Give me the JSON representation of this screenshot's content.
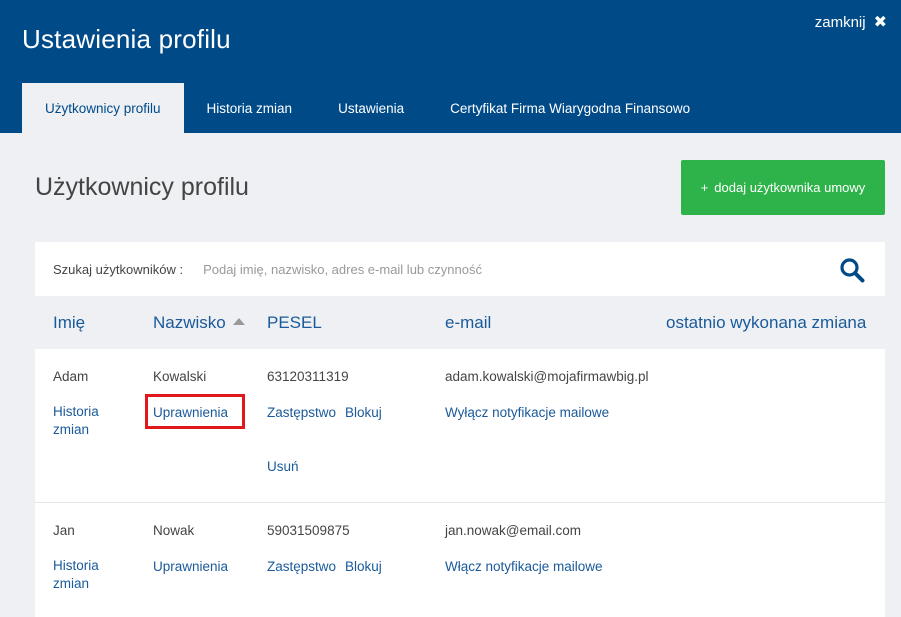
{
  "header": {
    "title": "Ustawienia profilu",
    "close_label": "zamknij",
    "close_icon": "✖"
  },
  "tabs": [
    {
      "label": "Użytkownicy profilu",
      "active": true
    },
    {
      "label": "Historia zmian",
      "active": false
    },
    {
      "label": "Ustawienia",
      "active": false
    },
    {
      "label": "Certyfikat Firma Wiarygodna Finansowo",
      "active": false
    }
  ],
  "main": {
    "title": "Użytkownicy profilu",
    "add_button_icon": "+",
    "add_button_label": "dodaj użytkownika umowy"
  },
  "search": {
    "label": "Szukaj użytkowników :",
    "placeholder": "Podaj imię, nazwisko, adres e-mail lub czynność",
    "value": ""
  },
  "table": {
    "columns": [
      "Imię",
      "Nazwisko",
      "PESEL",
      "e-mail",
      "ostatnio wykonana zmiana"
    ],
    "sort_column": "Nazwisko",
    "sort_direction": "ascending",
    "rows": [
      {
        "first_name": "Adam",
        "last_name": "Kowalski",
        "pesel": "63120311319",
        "email": "adam.kowalski@mojafirmawbig.pl",
        "history_link": "Historia zmian",
        "permissions_link": "Uprawnienia",
        "substitute_link": "Zastępstwo",
        "block_link": "Blokuj",
        "delete_link": "Usuń",
        "notify_link": "Wyłącz notyfikacje mailowe"
      },
      {
        "first_name": "Jan",
        "last_name": "Nowak",
        "pesel": "59031509875",
        "email": "jan.nowak@email.com",
        "history_link": "Historia zmian",
        "permissions_link": "Uprawnienia",
        "substitute_link": "Zastępstwo",
        "block_link": "Blokuj",
        "notify_link": "Włącz notyfikacje mailowe"
      }
    ]
  },
  "colors": {
    "header_bg": "#004a88",
    "accent_green": "#2eb34a",
    "link": "#1a5a9a",
    "highlight": "#e0181c"
  }
}
